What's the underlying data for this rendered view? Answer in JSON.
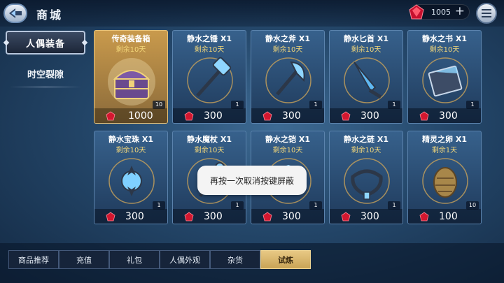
{
  "header": {
    "title": "商城",
    "currency_amount": "1005",
    "plus_symbol": "+"
  },
  "sidebar": {
    "items": [
      {
        "label": "人偶装备",
        "active": true
      },
      {
        "label": "时空裂隙",
        "active": false
      }
    ]
  },
  "shop": {
    "items": [
      {
        "name": "传奇装备箱",
        "remain": "剩余10天",
        "qty": "10",
        "price": "1000",
        "icon": "treasure-chest"
      },
      {
        "name": "静水之锤 X1",
        "remain": "剩余10天",
        "qty": "1",
        "price": "300",
        "icon": "hammer"
      },
      {
        "name": "静水之斧 X1",
        "remain": "剩余10天",
        "qty": "1",
        "price": "300",
        "icon": "axe"
      },
      {
        "name": "静水匕首 X1",
        "remain": "剩余10天",
        "qty": "1",
        "price": "300",
        "icon": "dagger"
      },
      {
        "name": "静水之书 X1",
        "remain": "剩余10天",
        "qty": "1",
        "price": "300",
        "icon": "book"
      },
      {
        "name": "静水宝珠 X1",
        "remain": "剩余10天",
        "qty": "1",
        "price": "300",
        "icon": "orb"
      },
      {
        "name": "静水魔杖 X1",
        "remain": "剩余10天",
        "qty": "1",
        "price": "300",
        "icon": "wand"
      },
      {
        "name": "静水之铠 X1",
        "remain": "剩余10天",
        "qty": "1",
        "price": "300",
        "icon": "armor"
      },
      {
        "name": "静水之链 X1",
        "remain": "剩余10天",
        "qty": "1",
        "price": "300",
        "icon": "chain"
      },
      {
        "name": "精灵之卵 X1",
        "remain": "剩余1天",
        "qty": "10",
        "price": "100",
        "icon": "egg"
      }
    ]
  },
  "toast": {
    "text": "再按一次取消按键屏蔽"
  },
  "tabs": [
    {
      "label": "商品推荐",
      "active": false
    },
    {
      "label": "充值",
      "active": false
    },
    {
      "label": "礼包",
      "active": false
    },
    {
      "label": "人偶外观",
      "active": false
    },
    {
      "label": "杂货",
      "active": false
    },
    {
      "label": "试炼",
      "active": true
    }
  ],
  "colors": {
    "gem": "#e0283c",
    "accent_gold": "#e8c985",
    "card_blue": "#37618c"
  }
}
